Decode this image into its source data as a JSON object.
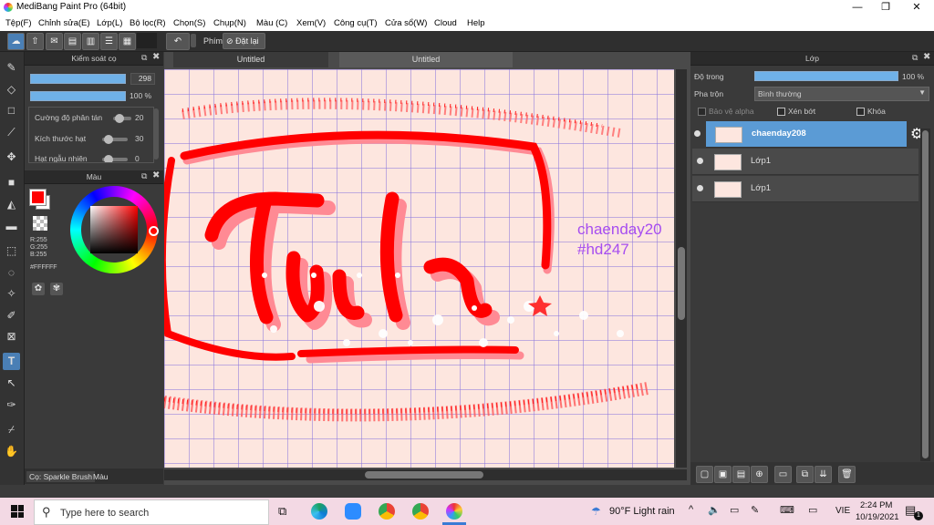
{
  "window": {
    "title": "MediBang Paint Pro (64bit)",
    "minimize": "—",
    "maximize": "❐",
    "close": "✕"
  },
  "menu": [
    "Tệp(F)",
    "Chỉnh sửa(E)",
    "Lớp(L)",
    "Bộ lọc(R)",
    "Chọn(S)",
    "Chụp(N)",
    "Màu (C)",
    "Xem(V)",
    "Công cụ(T)",
    "Cửa sổ(W)",
    "Cloud",
    "Help"
  ],
  "toolbar": {
    "key_label": "Phím",
    "reset_label": "Đặt lại"
  },
  "brush_panel": {
    "title": "Kiểm soát cọ",
    "size_value": "298",
    "opacity_value": "100 %",
    "props": [
      {
        "label": "Cường độ phân tán",
        "value": "20"
      },
      {
        "label": "Kích thước hạt",
        "value": "30"
      },
      {
        "label": "Hạt ngẫu nhiên",
        "value": "0"
      }
    ]
  },
  "color_panel": {
    "title": "Màu",
    "r": "R:255",
    "g": "G:255",
    "b": "B:255",
    "hex": "#FFFFFF",
    "fg_color": "#ff0000",
    "bg_color": "#ffffff"
  },
  "bottom_tabs": {
    "brush_tab": "Cọ: Sparkle Brush",
    "color_tab": "Màu"
  },
  "canvas": {
    "tabs": [
      "Untitled",
      "Untitled"
    ],
    "text_line1": "chaenday20",
    "text_line2": "#hd247",
    "paper_color": "#fde6df",
    "accent_red": "#ff1a1a"
  },
  "layer_panel": {
    "title": "Lớp",
    "opacity_label": "Độ trong",
    "opacity_value": "100 %",
    "opacity_fraction": 1.0,
    "blend_label": "Pha trộn",
    "blend_value": "Bình thường",
    "alpha_protect": "Bảo vệ alpha",
    "clipping": "Xén bớt",
    "lock": "Khóa",
    "layers": [
      "chaenday208",
      "Lớp1",
      "Lớp1"
    ],
    "selected_color": "#5b9bd5"
  },
  "taskbar": {
    "search_placeholder": "Type here to search",
    "weather": "90°F  Light rain",
    "language": "VIE",
    "time": "2:24 PM",
    "date": "10/19/2021",
    "notif_count": "1"
  }
}
